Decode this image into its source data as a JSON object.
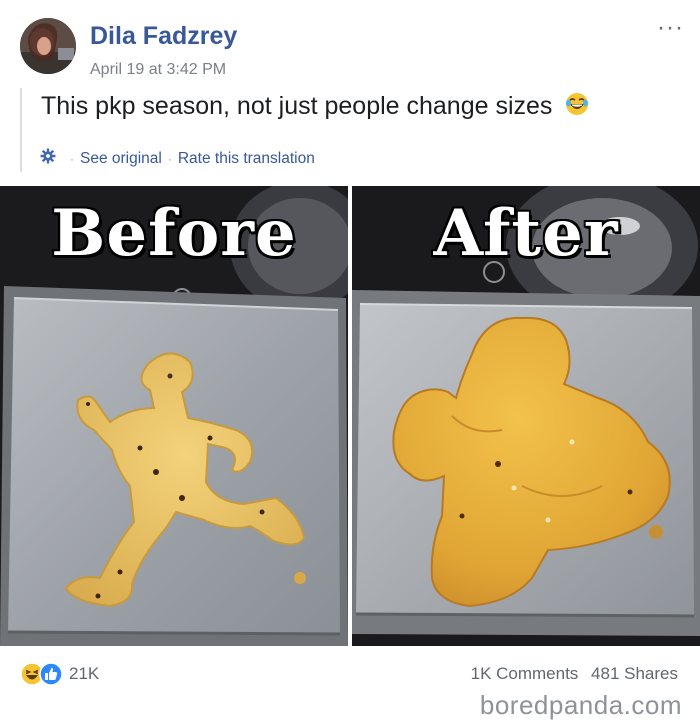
{
  "post": {
    "author": "Dila Fadzrey",
    "timestamp": "April 19 at 3:42 PM",
    "text": "This pkp season, not just people change sizes",
    "text_emoji": "laughing-crying-emoji",
    "translation": {
      "see_original": "See original",
      "separator": "·",
      "rate": "Rate this translation"
    },
    "more_icon": "···"
  },
  "photos": {
    "left_label": "Before",
    "right_label": "After"
  },
  "footer": {
    "reaction_icons": [
      "haha-icon",
      "like-icon"
    ],
    "reaction_count": "21K",
    "comments": "1K Comments",
    "shares": "481 Shares"
  },
  "watermark": "boredpanda.com",
  "colors": {
    "link": "#385898",
    "muted": "#606770"
  }
}
